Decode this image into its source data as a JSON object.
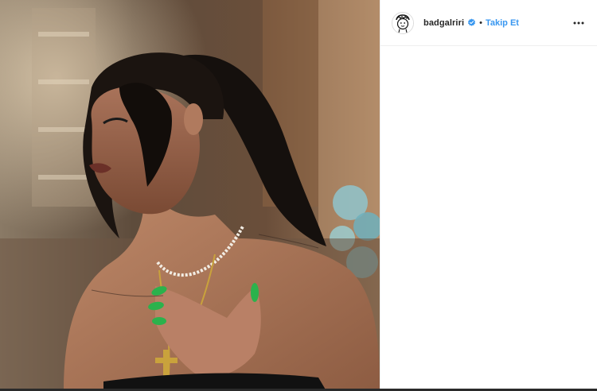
{
  "post": {
    "username": "badgalriri",
    "separator": "•",
    "follow_label": "Takip Et",
    "verified_icon": "verified-badge-icon",
    "more_icon": "more-options-icon",
    "avatar_icon": "profile-avatar-icon",
    "colors": {
      "follow": "#3897f0",
      "username": "#262626",
      "verified": "#3897f0",
      "divider": "#efefef"
    }
  },
  "photo": {
    "alt": "photo"
  }
}
